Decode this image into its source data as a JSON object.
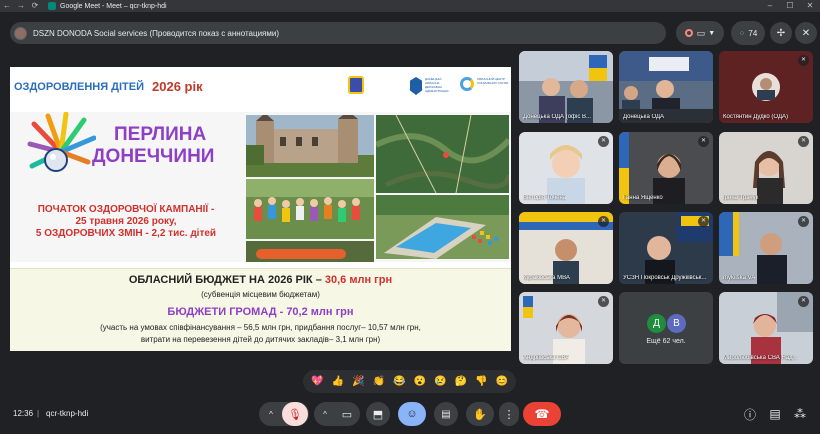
{
  "window": {
    "tab_title": "Google Meet - Meet – qcr-tknp-hdi",
    "back_icon": "arrow-left-icon",
    "forward_icon": "arrow-right-icon",
    "reload_icon": "reload-icon",
    "minimize": "–",
    "maximize": "☐",
    "close": "✕"
  },
  "topbar": {
    "presenter_text": "DSZN DONODA Social services (Проводится показ с аннотациями)",
    "people_count": "74"
  },
  "slide": {
    "title": "ОЗДОРОВЛЕННЯ ДІТЕЙ",
    "year": "2026 рік",
    "org1": "ДОНЕЦЬКА ОБЛАСНА ДЕРЖАВНА АДМІНІСТРАЦІЯ",
    "org2": "ОБЛАСНИЙ ЦЕНТР СОЦІАЛЬНИХ СЛУЖБ",
    "brand_line1": "ПЕРЛИНА",
    "brand_line2": "ДОНЕЧЧИНИ",
    "campaign_line1": "ПОЧАТОК ОЗДОРОВЧОЇ КАМПАНІЇ -",
    "campaign_line2": "25 травня 2026 року,",
    "campaign_line3": "5 ОЗДОРОВЧИХ ЗМІН  - 2,2 тис. дітей",
    "budget_label": "ОБЛАСНИЙ БЮДЖЕТ НА 2026 РІК – ",
    "budget_value": "30,6 млн грн",
    "budget_note": "(субвенція місцевим бюджетам)",
    "community_label": "БЮДЖЕТИ ГРОМАД - ",
    "community_value": "70,2 млн грн",
    "community_note1": "(участь на умовах співфінансування – 56,5 млн грн, придбання послуг– 10,57 млн грн,",
    "community_note2": "витрати на перевезення дітей до дитячих закладів– 3,1 млн грн)"
  },
  "participants": [
    {
      "name": "Донецька ОДА (офіс В...",
      "mic_off": false
    },
    {
      "name": "Донецька ОДА",
      "mic_off": false
    },
    {
      "name": "Костянтин Дудко (ОДА)",
      "mic_off": true
    },
    {
      "name": "Вікторія Точена",
      "mic_off": true
    },
    {
      "name": "Ганна Ященко",
      "mic_off": true
    },
    {
      "name": "Ірина Трачук",
      "mic_off": true
    },
    {
      "name": "Куракiвська МВА",
      "mic_off": true
    },
    {
      "name": "УСЗН Покровськ Дружківськ...",
      "mic_off": true
    },
    {
      "name": "mykilska VA",
      "mic_off": true
    },
    {
      "name": "Андріївська СВА",
      "mic_off": true
    },
    {
      "name": "Ещё 62 чел.",
      "mic_off": false
    },
    {
      "name": "Миролюбівська СВА Над...",
      "mic_off": true
    }
  ],
  "more_tile": {
    "initial1": "Д",
    "initial2": "В",
    "label": "Ещё 62 чел."
  },
  "reactions": [
    "💖",
    "👍",
    "🎉",
    "👏",
    "😂",
    "😮",
    "😢",
    "🤔",
    "👎",
    "😊"
  ],
  "bottombar": {
    "time": "12:36",
    "meeting_code": "qcr-tknp-hdi"
  },
  "colors": {
    "background": "#202124",
    "control": "#3c4043",
    "hangup": "#ea4335",
    "mic_off": "#f28b82",
    "active_blue": "#8ab4f8",
    "slide_purple": "#8e3fc6",
    "slide_red": "#d0312d",
    "slide_blue": "#2a6ebb"
  }
}
